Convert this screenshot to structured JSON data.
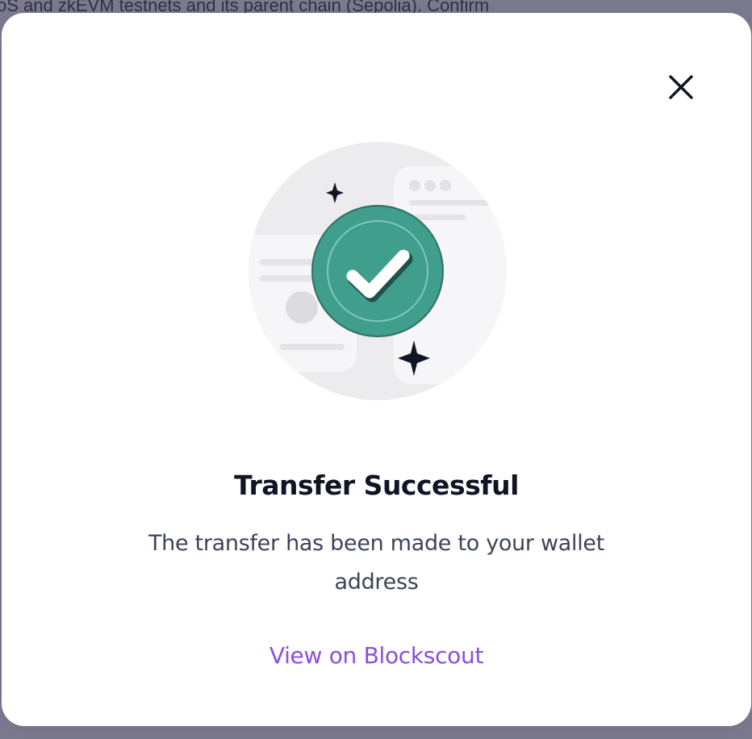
{
  "background": {
    "partial_text": "oS and zkEVM testnets and its parent chain (Sepolia). Confirm"
  },
  "modal": {
    "title": "Transfer Successful",
    "message": "The transfer has been made to your wallet address",
    "link_label": "View on Blockscout",
    "close_icon": "close-icon",
    "illustration_icon": "success-check-icon"
  },
  "colors": {
    "accent_link": "#8a4ee0",
    "success_green": "#3f9e8c",
    "title": "#0f1524",
    "body_text": "#3d4457",
    "overlay": "#7b7a8f"
  }
}
